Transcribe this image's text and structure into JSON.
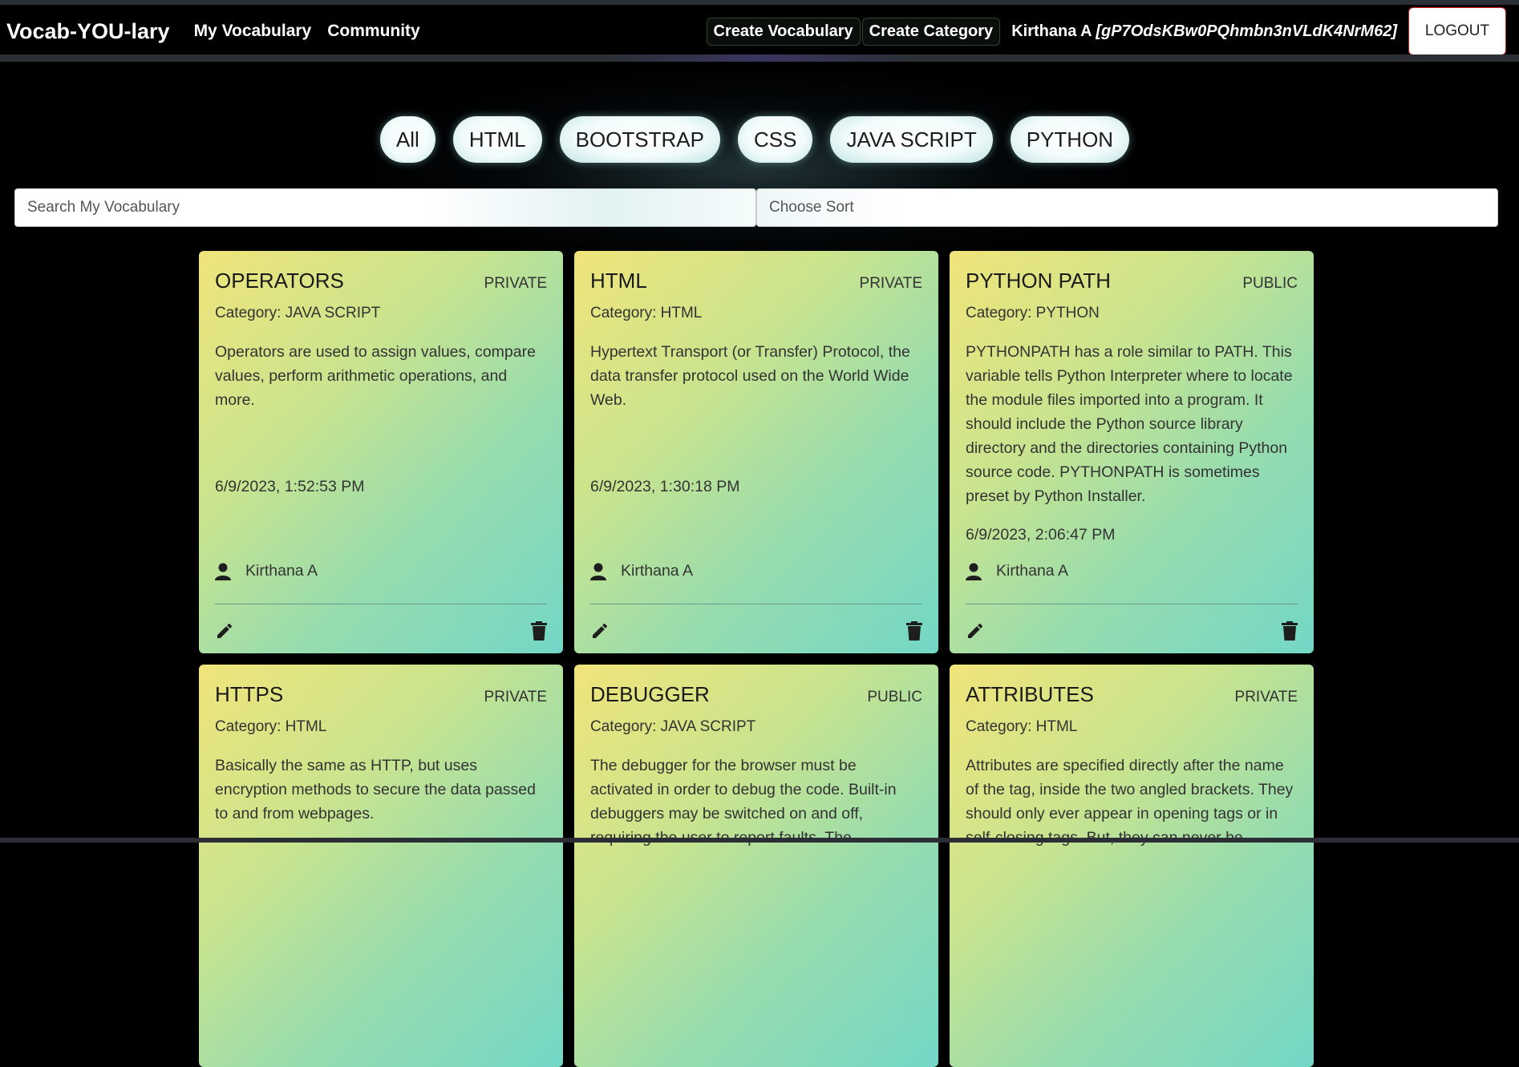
{
  "nav": {
    "brand": "Vocab-YOU-lary",
    "links": [
      "My Vocabulary",
      "Community"
    ],
    "create_vocab": "Create Vocabulary",
    "create_category": "Create Category",
    "user_name": "Kirthana A",
    "user_id": "[gP7OdsKBw0PQhmbn3nVLdK4NrM62]",
    "logout": "LOGOUT"
  },
  "filters": [
    "All",
    "HTML",
    "BOOTSTRAP",
    "CSS",
    "JAVA SCRIPT",
    "PYTHON"
  ],
  "search": {
    "placeholder": "Search My Vocabulary"
  },
  "sort": {
    "label": "Choose Sort"
  },
  "cards": [
    {
      "title": "OPERATORS",
      "visibility": "PRIVATE",
      "category": "Category: JAVA SCRIPT",
      "description": "Operators are used to assign values, compare values, perform arithmetic operations, and more.",
      "date": "6/9/2023, 1:52:53 PM",
      "author": "Kirthana A"
    },
    {
      "title": "HTML",
      "visibility": "PRIVATE",
      "category": "Category: HTML",
      "description": "Hypertext Transport (or Transfer) Protocol, the data transfer protocol used on the World Wide Web.",
      "date": "6/9/2023, 1:30:18 PM",
      "author": "Kirthana A"
    },
    {
      "title": "PYTHON PATH",
      "visibility": "PUBLIC",
      "category": "Category: PYTHON",
      "description": "PYTHONPATH has a role similar to PATH. This variable tells Python Interpreter where to locate the module files imported into a program. It should include the Python source library directory and the directories containing Python source code. PYTHONPATH is sometimes preset by Python Installer.",
      "date": "6/9/2023, 2:06:47 PM",
      "author": "Kirthana A"
    },
    {
      "title": "HTTPS",
      "visibility": "PRIVATE",
      "category": "Category: HTML",
      "description": "Basically the same as HTTP, but uses encryption methods to secure the data passed to and from webpages.",
      "date": "",
      "author": ""
    },
    {
      "title": "DEBUGGER",
      "visibility": "PUBLIC",
      "category": "Category: JAVA SCRIPT",
      "description": "The debugger for the browser must be activated in order to debug the code. Built-in debuggers may be switched on and off, requiring the user to report faults. The",
      "date": "",
      "author": ""
    },
    {
      "title": "ATTRIBUTES",
      "visibility": "PRIVATE",
      "category": "Category: HTML",
      "description": "Attributes are specified directly after the name of the tag, inside the two angled brackets. They should only ever appear in opening tags or in self-closing tags. But, they can never be",
      "date": "",
      "author": ""
    }
  ]
}
